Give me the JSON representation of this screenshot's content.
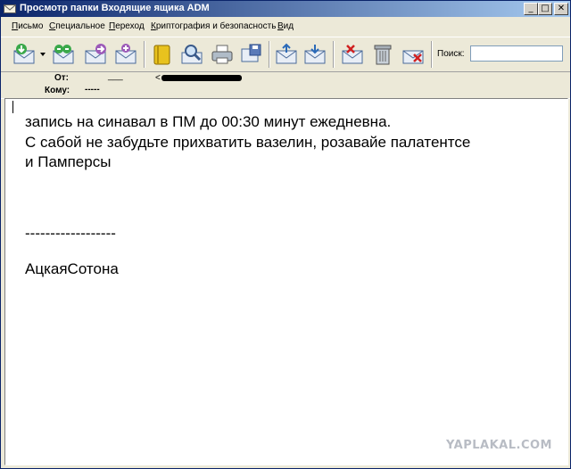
{
  "window": {
    "title": "Просмотр папки Входящие ящика ADM",
    "controls": {
      "minimize": "_",
      "maximize": "□",
      "close": "✕"
    }
  },
  "menu": {
    "items": [
      "Письмо",
      "Специальное",
      "Переход",
      "Криптография и безопасность",
      "Вид"
    ]
  },
  "toolbar": {
    "icons": [
      "receive-mail-icon",
      "send-receive-icon",
      "forward-mail-icon",
      "new-mail-icon",
      "address-book-icon",
      "find-icon",
      "print-icon",
      "save-icon",
      "move-icon",
      "copy-icon",
      "delete-mark-icon",
      "trash-icon",
      "delete-icon"
    ],
    "search_label": "Поиск:",
    "search_value": ""
  },
  "header": {
    "from_label": "От:",
    "from_value": "___",
    "from_addr_prefix": "<",
    "to_label": "Кому:",
    "to_value": "-----"
  },
  "message": {
    "lines": [
      "запись на синавал в ПМ до 00:30 минут ежедневна.",
      "С сабой не забудьте прихватить вазелин, розавайе палатентсе",
      "и Памперсы",
      "------------------",
      "АцкаяСотона"
    ]
  },
  "watermark": "YAPLAKAL.COM",
  "colors": {
    "titlebar_start": "#0a246a",
    "titlebar_end": "#a6caf0",
    "window_bg": "#ece9d8"
  }
}
